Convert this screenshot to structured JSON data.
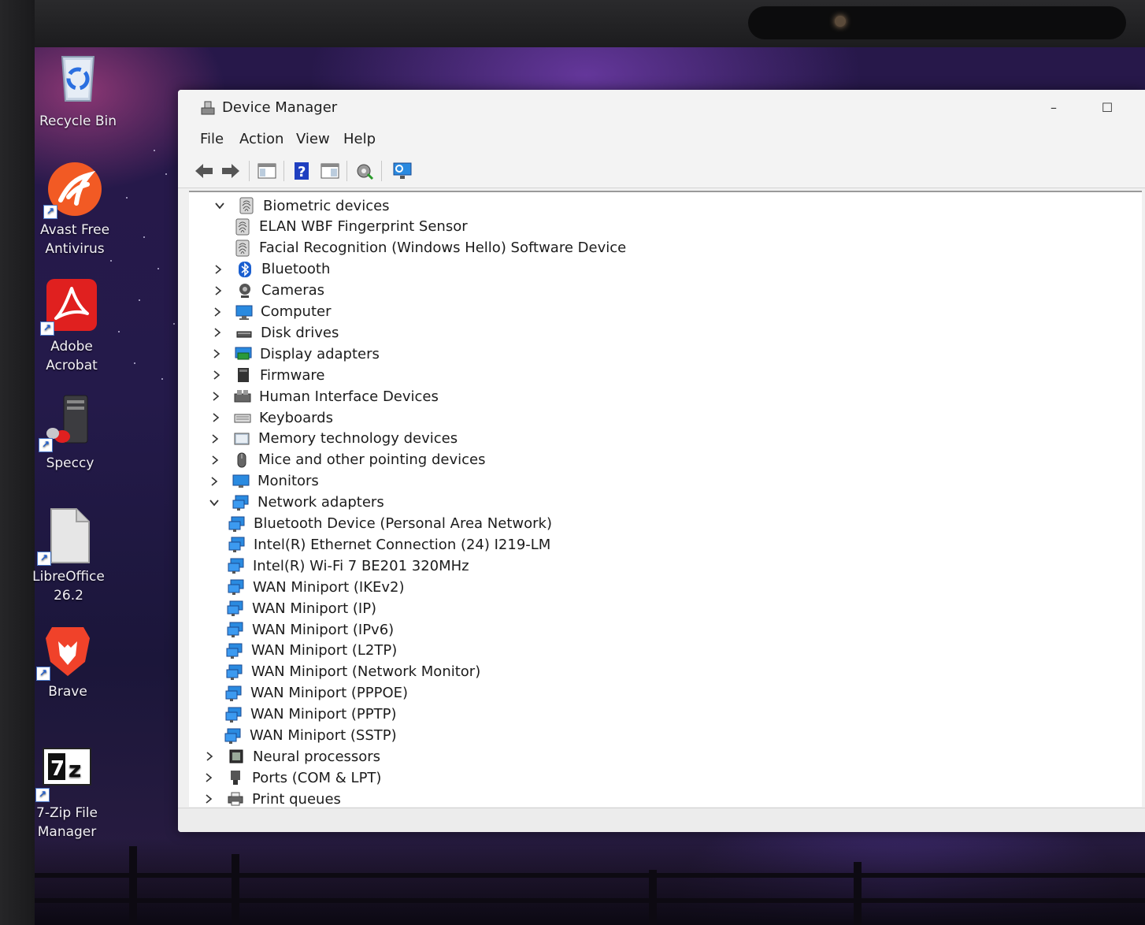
{
  "desktop": {
    "icons": [
      {
        "label": "Recycle Bin",
        "name": "recycle-bin-icon"
      },
      {
        "label": "Avast Free\nAntivirus",
        "name": "avast-icon"
      },
      {
        "label": "Adobe\nAcrobat",
        "name": "acrobat-icon"
      },
      {
        "label": "Speccy",
        "name": "speccy-icon"
      },
      {
        "label": "LibreOffice\n26.2",
        "name": "libreoffice-icon"
      },
      {
        "label": "Brave",
        "name": "brave-icon"
      },
      {
        "label": "7-Zip File\nManager",
        "name": "sevenzip-icon"
      }
    ]
  },
  "window": {
    "title": "Device Manager",
    "minimize": "–",
    "maximize": "☐",
    "menu": [
      "File",
      "Action",
      "View",
      "Help"
    ]
  },
  "colors": {
    "accent_blue": "#1a5fd0",
    "monitor_blue": "#2a8ae0",
    "window_bg": "#f0f0f0"
  },
  "tree": [
    {
      "label": "Biometric devices",
      "icon": "biometric-icon",
      "expanded": true,
      "level": 0
    },
    {
      "label": "ELAN WBF Fingerprint Sensor",
      "icon": "biometric-icon",
      "level": 1
    },
    {
      "label": "Facial Recognition (Windows Hello) Software Device",
      "icon": "biometric-icon",
      "level": 1
    },
    {
      "label": "Bluetooth",
      "icon": "bluetooth-icon",
      "expanded": false,
      "level": 0
    },
    {
      "label": "Cameras",
      "icon": "camera-icon",
      "expanded": false,
      "level": 0
    },
    {
      "label": "Computer",
      "icon": "computer-icon",
      "expanded": false,
      "level": 0
    },
    {
      "label": "Disk drives",
      "icon": "disk-icon",
      "expanded": false,
      "level": 0
    },
    {
      "label": "Display adapters",
      "icon": "display-adapter-icon",
      "expanded": false,
      "level": 0
    },
    {
      "label": "Firmware",
      "icon": "firmware-icon",
      "expanded": false,
      "level": 0
    },
    {
      "label": "Human Interface Devices",
      "icon": "hid-icon",
      "expanded": false,
      "level": 0
    },
    {
      "label": "Keyboards",
      "icon": "keyboard-icon",
      "expanded": false,
      "level": 0
    },
    {
      "label": "Memory technology devices",
      "icon": "memory-icon",
      "expanded": false,
      "level": 0
    },
    {
      "label": "Mice and other pointing devices",
      "icon": "mouse-icon",
      "expanded": false,
      "level": 0
    },
    {
      "label": "Monitors",
      "icon": "monitor-icon",
      "expanded": false,
      "level": 0
    },
    {
      "label": "Network adapters",
      "icon": "network-icon",
      "expanded": true,
      "level": 0
    },
    {
      "label": "Bluetooth Device (Personal Area Network)",
      "icon": "network-icon",
      "level": 1
    },
    {
      "label": "Intel(R) Ethernet Connection (24) I219-LM",
      "icon": "network-icon",
      "level": 1
    },
    {
      "label": "Intel(R) Wi-Fi 7 BE201 320MHz",
      "icon": "network-icon",
      "level": 1
    },
    {
      "label": "WAN Miniport (IKEv2)",
      "icon": "network-icon",
      "level": 1
    },
    {
      "label": "WAN Miniport (IP)",
      "icon": "network-icon",
      "level": 1
    },
    {
      "label": "WAN Miniport (IPv6)",
      "icon": "network-icon",
      "level": 1
    },
    {
      "label": "WAN Miniport (L2TP)",
      "icon": "network-icon",
      "level": 1
    },
    {
      "label": "WAN Miniport (Network Monitor)",
      "icon": "network-icon",
      "level": 1
    },
    {
      "label": "WAN Miniport (PPPOE)",
      "icon": "network-icon",
      "level": 1
    },
    {
      "label": "WAN Miniport (PPTP)",
      "icon": "network-icon",
      "level": 1
    },
    {
      "label": "WAN Miniport (SSTP)",
      "icon": "network-icon",
      "level": 1
    },
    {
      "label": "Neural processors",
      "icon": "npu-icon",
      "expanded": false,
      "level": 0
    },
    {
      "label": "Ports (COM & LPT)",
      "icon": "port-icon",
      "expanded": false,
      "level": 0
    },
    {
      "label": "Print queues",
      "icon": "printer-icon",
      "expanded": false,
      "level": 0
    }
  ]
}
